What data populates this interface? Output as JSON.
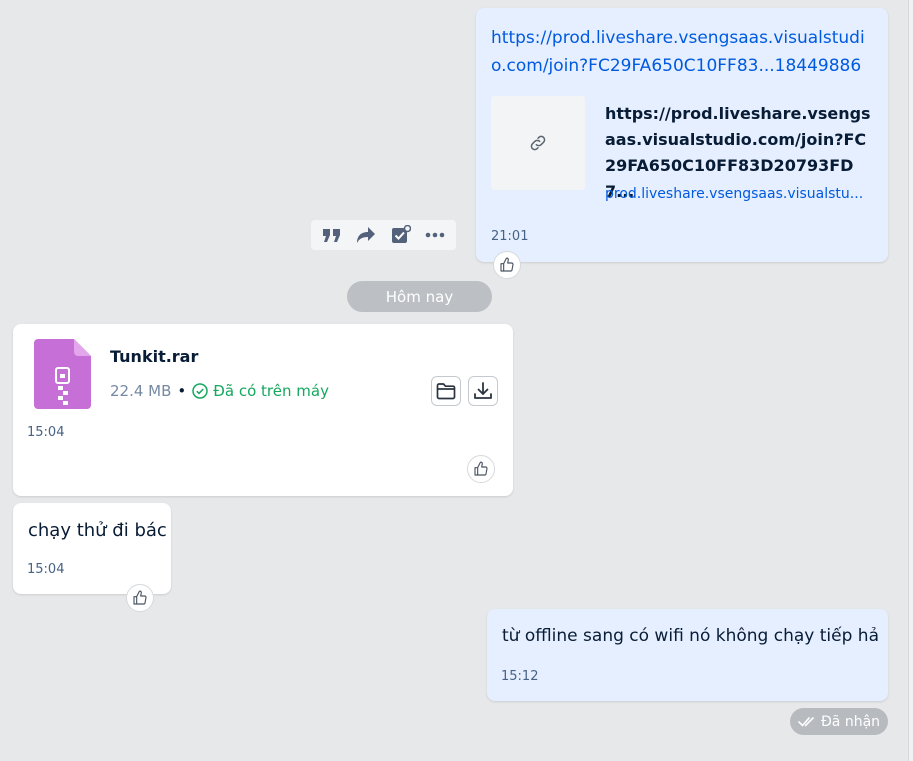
{
  "messages": {
    "link_share": {
      "url": "https://prod.liveshare.vsengsaas.visualstudio.com/join?FC29FA650C10FF83...18449886",
      "preview_title": "https://prod.liveshare.vsengsaas.visualstudio.com/join?FC29FA650C10FF83D20793FD7...",
      "preview_domain": "prod.liveshare.vsengsaas.visualstu...",
      "time": "21:01"
    },
    "file": {
      "name": "Tunkit.rar",
      "size": "22.4 MB",
      "separator": "•",
      "status": "Đã có trên máy",
      "time": "15:04"
    },
    "reply": {
      "text": "chạy thử đi bác",
      "time": "15:04"
    },
    "question": {
      "text": "từ offline sang có wifi nó không chạy tiếp hả",
      "time": "15:12"
    }
  },
  "date_separator": "Hôm nay",
  "delivery_status": "Đã nhận",
  "toolbar": {
    "icons": [
      "quote-icon",
      "forward-icon",
      "task-icon",
      "more-icon"
    ]
  },
  "colors": {
    "background": "#e7e8ea",
    "my_bubble": "#e5efff",
    "their_bubble": "#ffffff",
    "link": "#005ae0",
    "file_icon": "#c66fd6",
    "success": "#15a85f",
    "timestamp": "#476285"
  }
}
